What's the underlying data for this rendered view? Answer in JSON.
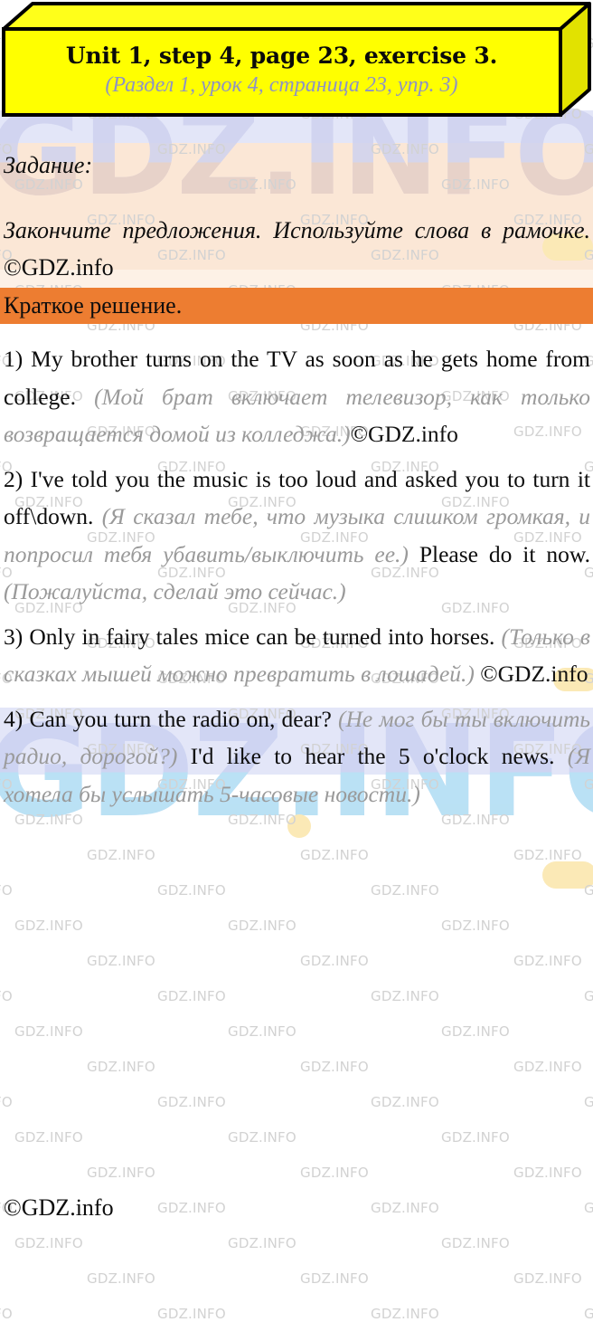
{
  "title_box": {
    "title_en": "Unit 1, step 4, page 23, exercise 3.",
    "title_ru": "(Раздел 1, урок 4, страница 23, упр. 3)",
    "face_color": "#ffff00",
    "side_color": "#e0e000",
    "top_color": "#ffff33",
    "border_color": "#000000"
  },
  "task": {
    "label": "Задание:",
    "body": "Закончите предложения. Используйте слова в рамочке.",
    "body_mark": "©GDZ.info"
  },
  "short_solution": {
    "label": "Краткое решение.",
    "band_color": "#ed7d31"
  },
  "answers": [
    {
      "number": "1)",
      "en": "My brother turns on the TV as soon as he gets home from college.",
      "ru": "(Мой брат включает телевизор, как только возвращается домой из колледжа.)",
      "mark": "©GDZ.info"
    },
    {
      "number": "2)",
      "en": "I've told you the music is too loud and asked you to turn it off\\down.",
      "ru": "(Я сказал тебе, что музыка слишком громкая, и попросил тебя убавить/выключить ее.)",
      "en2": "Please do it now.",
      "ru2": "(Пожалуйста, сделай это сейчас.)",
      "mark": ""
    },
    {
      "number": "3)",
      "en": "Only in fairy tales mice can be turned into horses.",
      "ru": "(Только в сказках мышей можно превратить в лошадей.)",
      "mark": "©GDZ.info"
    },
    {
      "number": "4)",
      "en": "Can you turn the radio on, dear?",
      "ru": "(Не мог бы ты включить радио, дорогой?)",
      "en2": "I'd like to hear the 5 o'clock news.",
      "ru2": "(Я хотела бы услышать 5-часовые новости.)",
      "mark": ""
    }
  ],
  "footer": {
    "mark": "©GDZ.info"
  },
  "watermark": {
    "big_text": "GDZ.INFO",
    "tile_text": "GDZ.INFO"
  }
}
